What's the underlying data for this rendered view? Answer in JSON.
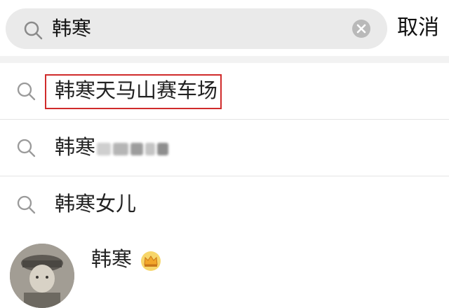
{
  "search": {
    "query": "韩寒",
    "cancel_label": "取消"
  },
  "suggestions": [
    {
      "text": "韩寒天马山赛车场"
    },
    {
      "text": "韩寒"
    },
    {
      "text": "韩寒女儿"
    }
  ],
  "user_result": {
    "name": "韩寒",
    "badge_icon": "crown-icon",
    "badge_color": "#f2a62a"
  },
  "colors": {
    "highlight": "#d02b2b",
    "search_bg": "#eaeaea"
  }
}
